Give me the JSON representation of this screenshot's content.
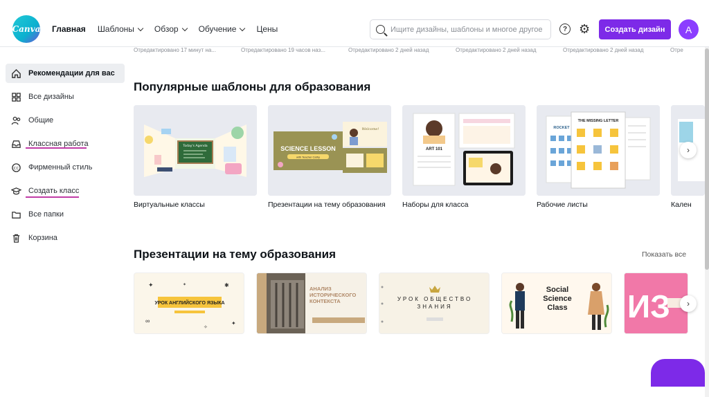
{
  "logo": {
    "text": "Canva"
  },
  "nav": {
    "items": [
      {
        "label": "Главная",
        "active": true,
        "dropdown": false
      },
      {
        "label": "Шаблоны",
        "active": false,
        "dropdown": true
      },
      {
        "label": "Обзор",
        "active": false,
        "dropdown": true
      },
      {
        "label": "Обучение",
        "active": false,
        "dropdown": true
      },
      {
        "label": "Цены",
        "active": false,
        "dropdown": false
      }
    ]
  },
  "search": {
    "placeholder": "Ищите дизайны, шаблоны и многое другое",
    "icon": "search-icon"
  },
  "header": {
    "help_label": "?",
    "create_label": "Создать дизайн",
    "avatar_letter": "A"
  },
  "colors": {
    "accent": "#7d2ae8",
    "avatar": "#8b3dff",
    "underline": "#c03ba6"
  },
  "sidebar": {
    "items": [
      {
        "label": "Рекомендации для вас",
        "icon": "home-icon",
        "active": true
      },
      {
        "label": "Все дизайны",
        "icon": "grid-icon",
        "active": false
      },
      {
        "label": "Общие",
        "icon": "people-icon",
        "active": false
      },
      {
        "label": "Классная работа",
        "icon": "inbox-icon",
        "active": false
      },
      {
        "label": "Фирменный стиль",
        "icon": "brand-icon",
        "active": false
      },
      {
        "label": "Создать класс",
        "icon": "graduation-cap-icon",
        "active": false
      },
      {
        "label": "Все папки",
        "icon": "folder-icon",
        "active": false
      },
      {
        "label": "Корзина",
        "icon": "trash-icon",
        "active": false
      }
    ]
  },
  "edited": [
    "Отредактировано 17 минут на...",
    "Отредактировано 19 часов наз...",
    "Отредактировано 2 дней назад",
    "Отредактировано 2 дней назад",
    "Отредактировано 2 дней назад",
    "Отре"
  ],
  "popular": {
    "title": "Популярные шаблоны для образования",
    "cards": [
      {
        "label": "Виртуальные классы",
        "thumb_text": "Today's Agenda"
      },
      {
        "label": "Презентации на тему образования",
        "thumb_text": "SCIENCE LESSON",
        "thumb_sub": "with Teacher Cathy",
        "thumb_side": "Welcome!"
      },
      {
        "label": "Наборы для класса",
        "thumb_text": "ART 101"
      },
      {
        "label": "Рабочие листы",
        "thumb_text": "THE MISSING LETTER",
        "thumb_side": "ROCKET"
      },
      {
        "label": "Кален"
      }
    ]
  },
  "presentations": {
    "title": "Презентации на тему образования",
    "show_all": "Показать все",
    "cards": [
      {
        "text": "УРОК АНГЛИЙСКОГО ЯЗЫКА"
      },
      {
        "text": "АНАЛИЗ ИСТОРИЧЕСКОГО КОНТЕКСТА"
      },
      {
        "text": "УРОК ОБЩЕСТВО ЗНАНИЯ"
      },
      {
        "text": "Social Science Class"
      },
      {
        "text": "ИЗ"
      }
    ]
  }
}
